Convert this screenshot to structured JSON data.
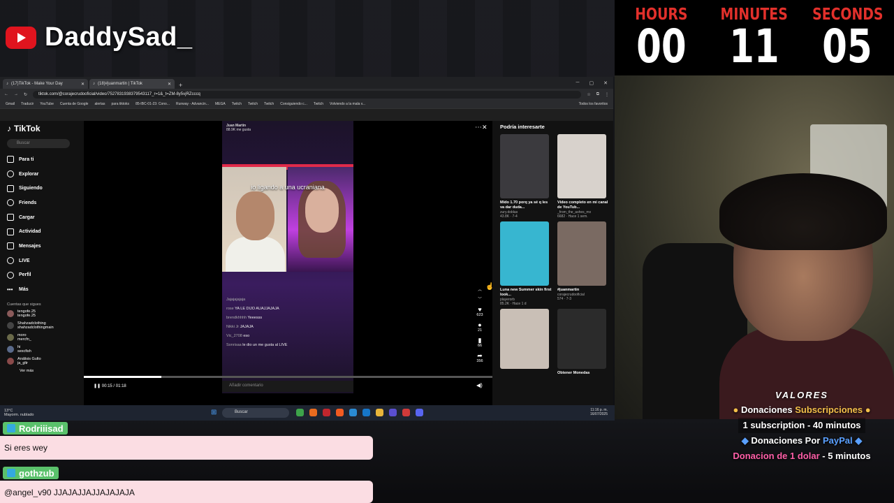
{
  "channel": {
    "name": "DaddySad_"
  },
  "timer": {
    "hours_label": "HOURS",
    "minutes_label": "MINUTES",
    "seconds_label": "SECONDS",
    "hours": "00",
    "minutes": "11",
    "seconds": "05"
  },
  "valores": {
    "title": "VALORES",
    "line1_a": "Donaciones",
    "line1_b": "Subscripciones",
    "line2": "1 subscription - 40 minutos",
    "line3_a": "Donaciones Por",
    "line3_b": "PayPal",
    "line4_a": "Donacion de 1 dolar",
    "line4_b": "- 5 minutos"
  },
  "browser": {
    "tabs": [
      {
        "label": "(17)TikTok - Make Your Day"
      },
      {
        "label": "(18)#juanmartin | TikTok"
      }
    ],
    "url": "tiktok.com/@corajecrudooficial/video/7527831938379543117_r=1&_t=ZM-8y5vjRZcccq",
    "bookmarks": [
      "Gmail",
      "Traducir",
      "YouTube",
      "Cuenta de Google",
      "alertas",
      "para tiktoks",
      "85-IBC-01-23: Cono...",
      "Runway - Advancin...",
      "MEGA",
      "Twitch",
      "Twitch",
      "Twitch",
      "Consiguiendo c...",
      "Twitch",
      "Volviendo a la mala v...",
      "Todos los favoritos"
    ]
  },
  "tiktok": {
    "logo": "TikTok",
    "search_placeholder": "Buscar",
    "nav": [
      "Para ti",
      "Explorar",
      "Siguiendo",
      "Friends",
      "Cargar",
      "Actividad",
      "Mensajes",
      "LIVE",
      "Perfil",
      "Más"
    ],
    "following_title": "Cuentas que sigues",
    "following": [
      {
        "name": "tengofe.25",
        "sub": "tengofe.25"
      },
      {
        "name": "Shahzadclothing",
        "sub": "shahzadclothingmain"
      },
      {
        "name": "moro",
        "sub": "mercfn_"
      },
      {
        "name": "hi",
        "sub": "sexcfish"
      },
      {
        "name": "Análisis Gulto",
        "sub": "ja_gltr"
      }
    ],
    "see_more": "Ver más",
    "video": {
      "creator": "Juan Martin",
      "likes_top": "88.9K me gusta",
      "follow_count": "1.0K",
      "title": "io ligando a una ucraniana",
      "chat": [
        {
          "u": "Jajajajajaja",
          "m": ""
        },
        {
          "u": "rose",
          "m": "YA LE DIJO AUAJJAJAJA"
        },
        {
          "u": "brendkhhhh",
          "m": "Yeeesss"
        },
        {
          "u": "Nikki Jr",
          "m": "JAJAJA"
        },
        {
          "u": "Vic_2708",
          "m": "eso"
        },
        {
          "u": "Sonrisaa",
          "m": "le dio un me gusta al LIVE"
        }
      ],
      "comment_placeholder": "Añadir comentario",
      "time": "00:15 / 01:18",
      "progress": 0.19,
      "stats": {
        "likes": "623",
        "comments": "21",
        "saves": "66",
        "shares": "356"
      },
      "author_handle": "corajecrudooficial"
    },
    "rec_title": "Podría interesarte",
    "recs": [
      {
        "title": "Mido 1.70 porq ya sé q les va dar duda...",
        "author": "zury.doblas",
        "stats": "43.8K · 7-4",
        "color": "#3b3a3e"
      },
      {
        "title": "Video completo en mi canal de YouTub...",
        "author": "_from_the_ashes_mx",
        "stats": "6682 · Hace 1 sem.",
        "color": "#d8d2cc"
      },
      {
        "title": "Luna new Summer skin first look...",
        "author": "playerorb",
        "stats": "85.2K · Hace 1 d",
        "color": "#37b6d0"
      },
      {
        "title": "#juanmartin",
        "author": "corajecrudooficial",
        "stats": "574 · 7-3",
        "color": "#7a6a62"
      },
      {
        "title": "",
        "author": "",
        "stats": "",
        "color": "#c9bfb6"
      },
      {
        "title": "Obtener Monedas",
        "author": "",
        "stats": "",
        "color": "#2b2b2b"
      }
    ]
  },
  "taskbar": {
    "weather": "13°C",
    "weather_sub": "Mayorm. nublado",
    "search": "Buscar",
    "time": "11:16 p. m.",
    "date": "16/07/2025"
  },
  "chat": [
    {
      "user": "Rodriiisad",
      "message": "Si eres wey",
      "color": "#5ac16b"
    },
    {
      "user": "gothzub",
      "message": "@angel_v90 JJAJAJJAJJAJAJAJA",
      "color": "#5ac16b"
    }
  ]
}
